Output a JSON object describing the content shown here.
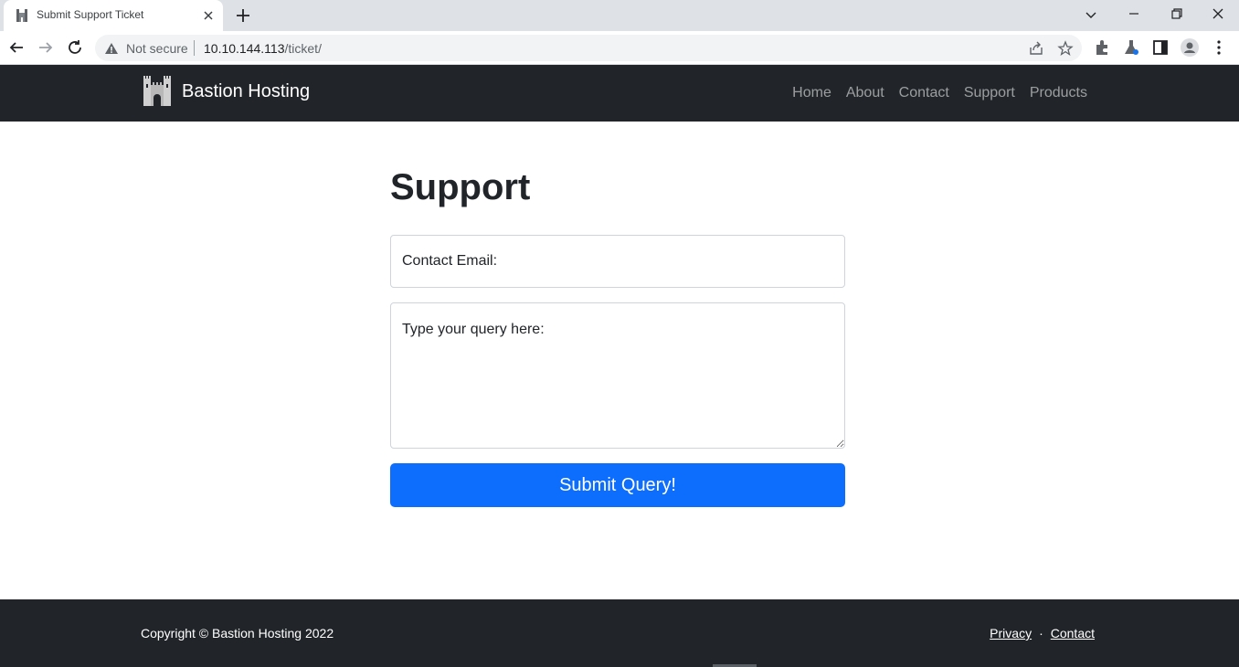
{
  "browser": {
    "tab_title": "Submit Support Ticket",
    "security_label": "Not secure",
    "url_host": "10.10.144.113",
    "url_path": "/ticket/"
  },
  "site": {
    "brand_name": "Bastion Hosting",
    "nav": [
      "Home",
      "About",
      "Contact",
      "Support",
      "Products"
    ]
  },
  "page": {
    "heading": "Support",
    "email_placeholder": "Contact Email:",
    "query_placeholder": "Type your query here:",
    "submit_label": "Submit Query!"
  },
  "footer": {
    "copyright": "Copyright © Bastion Hosting 2022",
    "links": [
      "Privacy",
      "Contact"
    ],
    "separator": "·"
  },
  "colors": {
    "navbar_bg": "#212529",
    "primary": "#0d6efd"
  }
}
